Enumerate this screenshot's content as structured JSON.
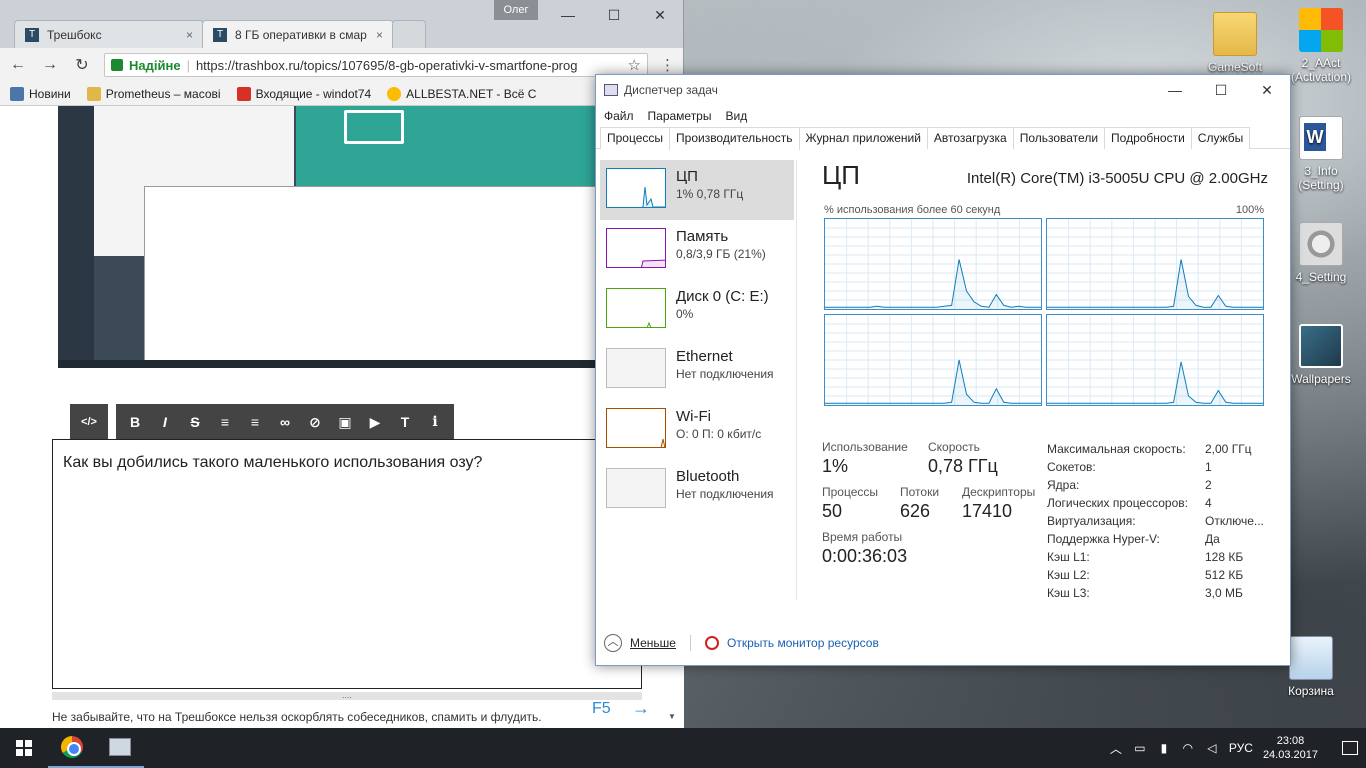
{
  "browser": {
    "profile_name": "Олег",
    "tabs": [
      {
        "label": "Трешбокс",
        "close": "×"
      },
      {
        "label": "8 ГБ оперативки в смар",
        "close": "×"
      }
    ],
    "secure_label": "Надійне",
    "url": "https://trashbox.ru/topics/107695/8-gb-operativki-v-smartfone-prog",
    "bookmarks": [
      {
        "label": "Новини",
        "color": "#4a76a8"
      },
      {
        "label": "Prometheus – масові",
        "color": "#e0b84a"
      },
      {
        "label": "Входящие - windot74",
        "color": "#d93025"
      },
      {
        "label": "ALLBESTA.NET - Всё С",
        "color": "#fbbc04"
      }
    ],
    "editor": {
      "text": "Как вы добились такого маленького использования озу?",
      "toolbar": {
        "code": "</>",
        "bold": "B",
        "italic": "I",
        "strike": "S",
        "ol": "≡",
        "ul": "≡",
        "link": "∞",
        "unlink": "⊘",
        "image": "▣",
        "video": "▶",
        "text": "T",
        "info": "i"
      }
    },
    "grip": "....",
    "rules_note": "Не забывайте, что на Трешбоксе нельзя оскорблять собеседников, спамить и флудить.",
    "f5": "F5",
    "arrow": "→"
  },
  "taskmgr": {
    "title": "Диспетчер задач",
    "menu": [
      "Файл",
      "Параметры",
      "Вид"
    ],
    "tabs": [
      "Процессы",
      "Производительность",
      "Журнал приложений",
      "Автозагрузка",
      "Пользователи",
      "Подробности",
      "Службы"
    ],
    "resources": [
      {
        "name": "ЦП",
        "sub": "1% 0,78 ГГц",
        "color": "#117dbb"
      },
      {
        "name": "Память",
        "sub": "0,8/3,9 ГБ (21%)",
        "color": "#8b12ae"
      },
      {
        "name": "Диск 0 (C: E:)",
        "sub": "0%",
        "color": "#4da60c"
      },
      {
        "name": "Ethernet",
        "sub": "Нет подключения",
        "color": "#a0a0a0"
      },
      {
        "name": "Wi-Fi",
        "sub": "О: 0 П: 0 кбит/с",
        "color": "#a74f01"
      },
      {
        "name": "Bluetooth",
        "sub": "Нет подключения",
        "color": "#a0a0a0"
      }
    ],
    "cpu": {
      "heading": "ЦП",
      "model": "Intel(R) Core(TM) i3-5005U CPU @ 2.00GHz",
      "graph_caption": "% использования более 60 секунд",
      "graph_max": "100%",
      "stats": {
        "usage_label": "Использование",
        "usage": "1%",
        "speed_label": "Скорость",
        "speed": "0,78 ГГц",
        "processes_label": "Процессы",
        "processes": "50",
        "threads_label": "Потоки",
        "threads": "626",
        "handles_label": "Дескрипторы",
        "handles": "17410",
        "uptime_label": "Время работы",
        "uptime": "0:00:36:03"
      },
      "specs": [
        {
          "k": "Максимальная скорость:",
          "v": "2,00 ГГц"
        },
        {
          "k": "Сокетов:",
          "v": "1"
        },
        {
          "k": "Ядра:",
          "v": "2"
        },
        {
          "k": "Логических процессоров:",
          "v": "4"
        },
        {
          "k": "Виртуализация:",
          "v": "Отключе..."
        },
        {
          "k": "Поддержка Hyper-V:",
          "v": "Да"
        },
        {
          "k": "Кэш L1:",
          "v": "128 КБ"
        },
        {
          "k": "Кэш L2:",
          "v": "512 КБ"
        },
        {
          "k": "Кэш L3:",
          "v": "3,0 МБ"
        }
      ]
    },
    "footer": {
      "fewer": "Меньше",
      "monitor": "Открыть монитор ресурсов"
    }
  },
  "desktop_icons": [
    {
      "label": "GameSoft",
      "kind": "folder"
    },
    {
      "label": "2_AAct\n(Activation)",
      "kind": "win"
    },
    {
      "label": "3_Info\n(Setting)",
      "kind": "word"
    },
    {
      "label": "4_Setting",
      "kind": "gear"
    },
    {
      "label": "Wallpapers",
      "kind": "pic"
    },
    {
      "label": "Корзина",
      "kind": "bin"
    }
  ],
  "taskbar": {
    "language": "РУС",
    "time": "23:08",
    "date": "24.03.2017"
  }
}
